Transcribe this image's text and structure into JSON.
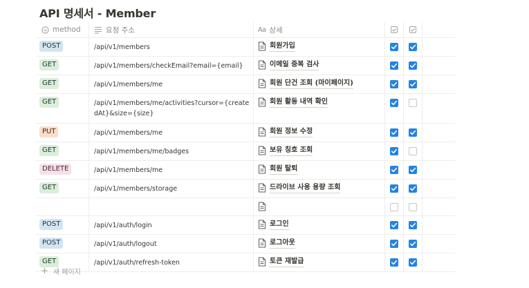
{
  "title": "API 명세서 - Member",
  "columns": {
    "method": "method",
    "url": "요청 주소",
    "desc": "상세",
    "desc_prefix": "Aa"
  },
  "colors": {
    "POST": {
      "bg": "#d3e5ef",
      "fg": "#183347"
    },
    "GET": {
      "bg": "#dbeddb",
      "fg": "#1c3829"
    },
    "PUT": {
      "bg": "#fadec9",
      "fg": "#49290e"
    },
    "DELETE": {
      "bg": "#f5e0e9",
      "fg": "#4c2337"
    },
    "checkbox": "#2383e2"
  },
  "rows": [
    {
      "method": "POST",
      "url": "/api/v1/members",
      "desc": "회원가입",
      "c1": true,
      "c2": true
    },
    {
      "method": "GET",
      "url": "/api/v1/members/checkEmail?email={email}",
      "desc": "이메일 중복 검사",
      "c1": true,
      "c2": true
    },
    {
      "method": "GET",
      "url": "/api/v1/members/me",
      "desc": "회원 단건 조회 (마이페이지)",
      "c1": true,
      "c2": true
    },
    {
      "method": "GET",
      "url": "/api/v1/members/me/activities?cursor={createdAt}&size={size}",
      "desc": "회원 활동 내역 확인",
      "c1": true,
      "c2": false
    },
    {
      "method": "PUT",
      "url": "/api/v1/members/me",
      "desc": "회원 정보 수정",
      "c1": true,
      "c2": true
    },
    {
      "method": "GET",
      "url": "/api/v1/members/me/badges",
      "desc": "보유 칭호 조회",
      "c1": true,
      "c2": false
    },
    {
      "method": "DELETE",
      "url": "/api/v1/members/me",
      "desc": "회원 탈퇴",
      "c1": true,
      "c2": true
    },
    {
      "method": "GET",
      "url": "/api/v1/members/storage",
      "desc": "드라이브 사용 용량 조회",
      "c1": true,
      "c2": true
    },
    {
      "method": "",
      "url": "",
      "desc": "",
      "c1": false,
      "c2": false
    },
    {
      "method": "POST",
      "url": "/api/v1/auth/login",
      "desc": "로그인",
      "c1": true,
      "c2": true
    },
    {
      "method": "POST",
      "url": "/api/v1/auth/logout",
      "desc": "로그아웃",
      "c1": true,
      "c2": true
    },
    {
      "method": "GET",
      "url": "/api/v1/auth/refresh-token",
      "desc": "토큰 재발급",
      "c1": true,
      "c2": true
    }
  ],
  "new_page": "새 페이지"
}
